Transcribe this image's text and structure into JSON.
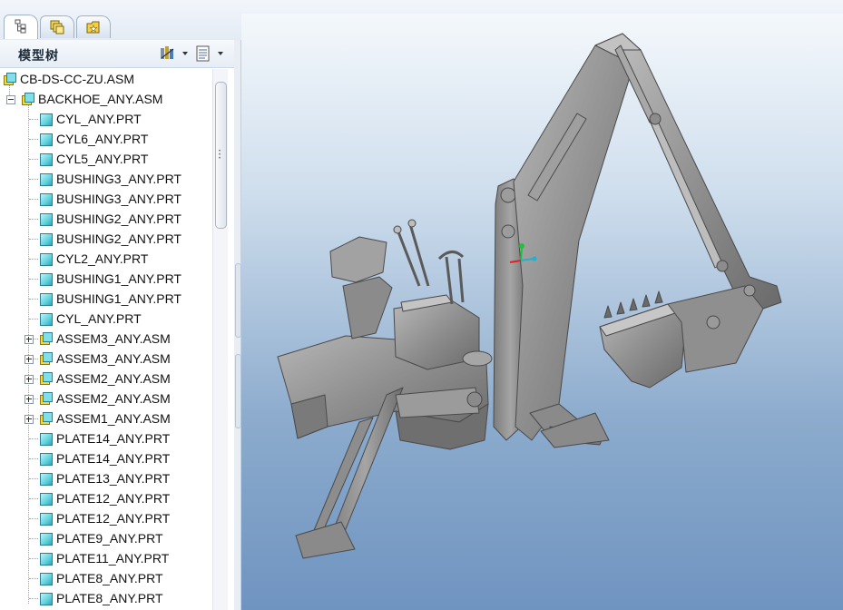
{
  "tabs": [
    {
      "name": "model-tree-tab",
      "icon": "tree-icon",
      "active": true
    },
    {
      "name": "layers-tab",
      "icon": "layers-icon",
      "active": false
    },
    {
      "name": "favorites-tab",
      "icon": "folder-star-icon",
      "active": false
    }
  ],
  "panel": {
    "title": "模型树",
    "settings_icon": "tree-settings-icon",
    "show_icon": "tree-show-icon"
  },
  "tree": {
    "items": [
      {
        "label": "CB-DS-CC-ZU.ASM",
        "kind": "asm",
        "level": 0,
        "expander": "none"
      },
      {
        "label": "BACKHOE_ANY.ASM",
        "kind": "asm",
        "level": 1,
        "expander": "minus"
      },
      {
        "label": "CYL_ANY.PRT",
        "kind": "prt",
        "level": 2,
        "expander": "none"
      },
      {
        "label": "CYL6_ANY.PRT",
        "kind": "prt",
        "level": 2,
        "expander": "none"
      },
      {
        "label": "CYL5_ANY.PRT",
        "kind": "prt",
        "level": 2,
        "expander": "none"
      },
      {
        "label": "BUSHING3_ANY.PRT",
        "kind": "prt",
        "level": 2,
        "expander": "none"
      },
      {
        "label": "BUSHING3_ANY.PRT",
        "kind": "prt",
        "level": 2,
        "expander": "none"
      },
      {
        "label": "BUSHING2_ANY.PRT",
        "kind": "prt",
        "level": 2,
        "expander": "none"
      },
      {
        "label": "BUSHING2_ANY.PRT",
        "kind": "prt",
        "level": 2,
        "expander": "none"
      },
      {
        "label": "CYL2_ANY.PRT",
        "kind": "prt",
        "level": 2,
        "expander": "none"
      },
      {
        "label": "BUSHING1_ANY.PRT",
        "kind": "prt",
        "level": 2,
        "expander": "none"
      },
      {
        "label": "BUSHING1_ANY.PRT",
        "kind": "prt",
        "level": 2,
        "expander": "none"
      },
      {
        "label": "CYL_ANY.PRT",
        "kind": "prt",
        "level": 2,
        "expander": "none"
      },
      {
        "label": "ASSEM3_ANY.ASM",
        "kind": "asm",
        "level": 2,
        "expander": "plus"
      },
      {
        "label": "ASSEM3_ANY.ASM",
        "kind": "asm",
        "level": 2,
        "expander": "plus"
      },
      {
        "label": "ASSEM2_ANY.ASM",
        "kind": "asm",
        "level": 2,
        "expander": "plus"
      },
      {
        "label": "ASSEM2_ANY.ASM",
        "kind": "asm",
        "level": 2,
        "expander": "plus"
      },
      {
        "label": "ASSEM1_ANY.ASM",
        "kind": "asm",
        "level": 2,
        "expander": "plus"
      },
      {
        "label": "PLATE14_ANY.PRT",
        "kind": "prt",
        "level": 2,
        "expander": "none"
      },
      {
        "label": "PLATE14_ANY.PRT",
        "kind": "prt",
        "level": 2,
        "expander": "none"
      },
      {
        "label": "PLATE13_ANY.PRT",
        "kind": "prt",
        "level": 2,
        "expander": "none"
      },
      {
        "label": "PLATE12_ANY.PRT",
        "kind": "prt",
        "level": 2,
        "expander": "none"
      },
      {
        "label": "PLATE12_ANY.PRT",
        "kind": "prt",
        "level": 2,
        "expander": "none"
      },
      {
        "label": "PLATE9_ANY.PRT",
        "kind": "prt",
        "level": 2,
        "expander": "none"
      },
      {
        "label": "PLATE11_ANY.PRT",
        "kind": "prt",
        "level": 2,
        "expander": "none"
      },
      {
        "label": "PLATE8_ANY.PRT",
        "kind": "prt",
        "level": 2,
        "expander": "none"
      },
      {
        "label": "PLATE8_ANY.PRT",
        "kind": "prt",
        "level": 2,
        "expander": "none"
      }
    ]
  },
  "viewport": {
    "model": "backhoe-assembly",
    "axis_colors": {
      "x": "#e02020",
      "y": "#20c040",
      "z": "#20b0d0"
    }
  }
}
